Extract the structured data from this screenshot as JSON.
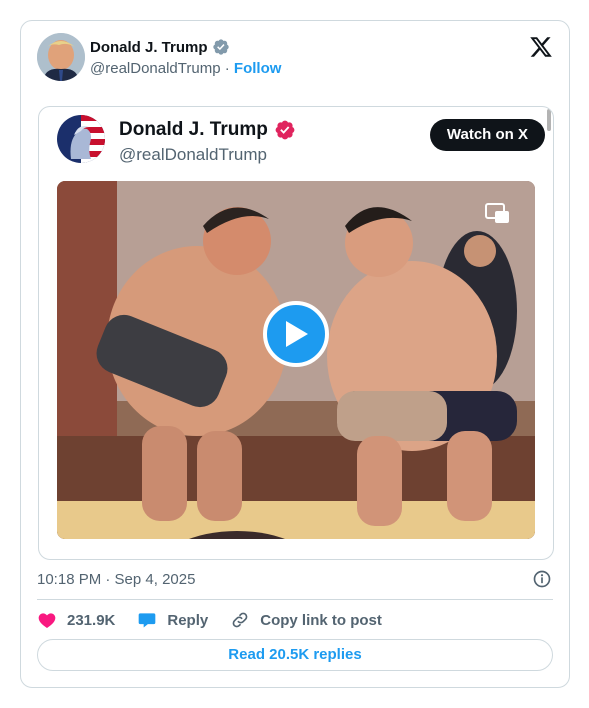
{
  "author": {
    "display_name": "Donald J. Trump",
    "handle": "@realDonaldTrump",
    "separator": "·",
    "follow_label": "Follow",
    "verified_badge": "verified-badge-gray"
  },
  "embedded_post": {
    "display_name": "Donald J. Trump",
    "handle": "@realDonaldTrump",
    "watch_label": "Watch on X",
    "verified_badge": "verified-badge-red",
    "video": {
      "media_icon": "picture-in-picture-icon",
      "play_icon": "play-icon"
    }
  },
  "timestamp": "10:18 PM · Sep 4, 2025",
  "actions": {
    "likes_count": "231.9K",
    "reply_label": "Reply",
    "copy_link_label": "Copy link to post"
  },
  "read_replies_label": "Read 20.5K replies",
  "colors": {
    "accent": "#1d9bf0",
    "like": "#f91880",
    "muted_text": "#536471",
    "border": "#cfd9de",
    "verified_red": "#e0245e"
  }
}
